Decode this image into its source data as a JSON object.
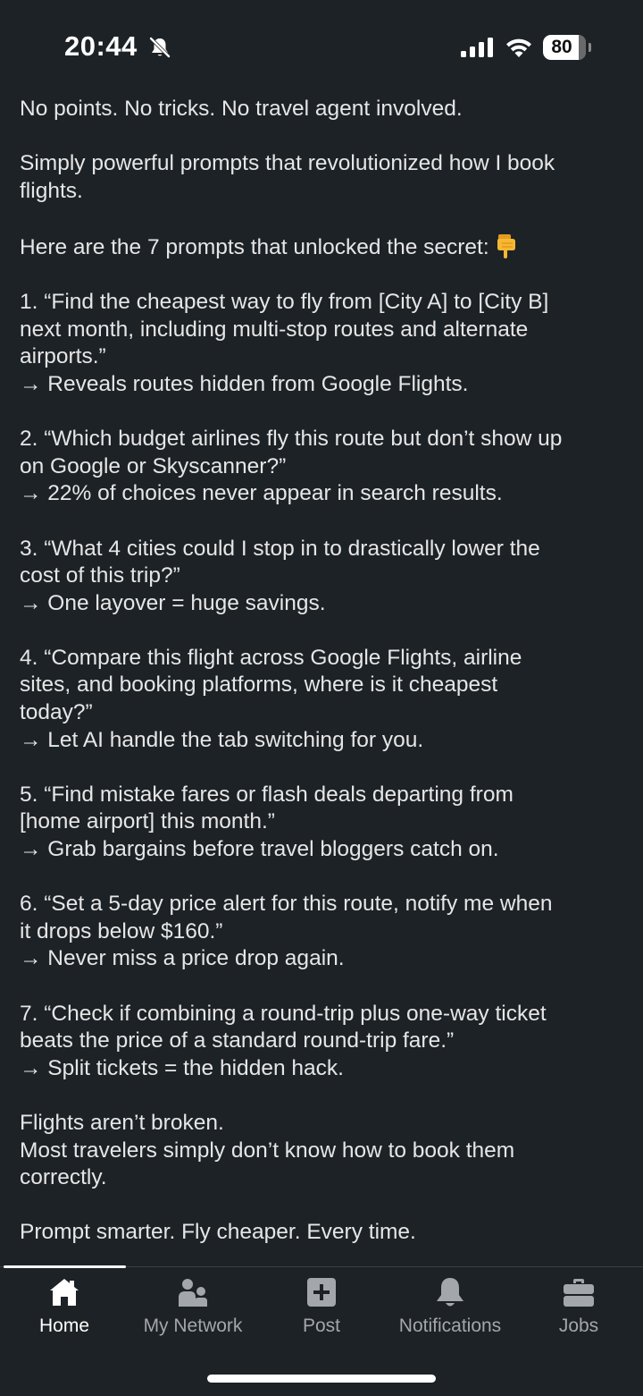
{
  "status_bar": {
    "time": "20:44",
    "battery_level": "80",
    "icons": [
      "bell-off-icon",
      "cellular-signal-icon",
      "wifi-icon",
      "battery-icon"
    ]
  },
  "post": {
    "paragraphs": [
      [
        "No points. No tricks. No travel agent involved."
      ],
      [
        "Simply powerful prompts that revolutionized how I book",
        "flights."
      ],
      [
        "Here are the 7 prompts that unlocked the secret:"
      ],
      [
        "1. “Find the cheapest way to fly from [City A] to [City B]",
        "next month, including multi-stop routes and alternate",
        "airports.”",
        "→ Reveals routes hidden from Google Flights."
      ],
      [
        "2. “Which budget airlines fly this route but don’t show up",
        "on Google or Skyscanner?”",
        "→ 22% of choices never appear in search results."
      ],
      [
        "3. “What 4 cities could I stop in to drastically lower the",
        "cost of this trip?”",
        "→ One layover = huge savings."
      ],
      [
        "4. “Compare this flight across Google Flights, airline",
        "sites, and booking platforms, where is it cheapest",
        "today?”",
        "→ Let AI handle the tab switching for you."
      ],
      [
        "5. “Find mistake fares or flash deals departing from",
        "[home airport] this month.”",
        "→ Grab bargains before travel bloggers catch on."
      ],
      [
        "6. “Set a 5-day price alert for this route, notify me when",
        "it drops below $160.”",
        "→ Never miss a price drop again."
      ],
      [
        "7. “Check if combining a round-trip plus one-way ticket",
        "beats the price of a standard round-trip fare.”",
        "→ Split tickets = the hidden hack."
      ],
      [
        "Flights aren’t broken.",
        "Most travelers simply don’t know how to book them",
        "correctly."
      ],
      [
        "Prompt smarter. Fly cheaper. Every time."
      ]
    ],
    "emoji": "backhand-index-pointing-down-icon"
  },
  "bottom_nav": {
    "active": "Home",
    "items": [
      {
        "label": "Home",
        "icon": "home-icon"
      },
      {
        "label": "My Network",
        "icon": "network-icon"
      },
      {
        "label": "Post",
        "icon": "post-plus-icon"
      },
      {
        "label": "Notifications",
        "icon": "bell-icon"
      },
      {
        "label": "Jobs",
        "icon": "briefcase-icon"
      }
    ]
  },
  "colors": {
    "background": "#1d2226",
    "text": "#e6e6e6",
    "nav_inactive": "#a3a7ab",
    "nav_active": "#ffffff"
  }
}
